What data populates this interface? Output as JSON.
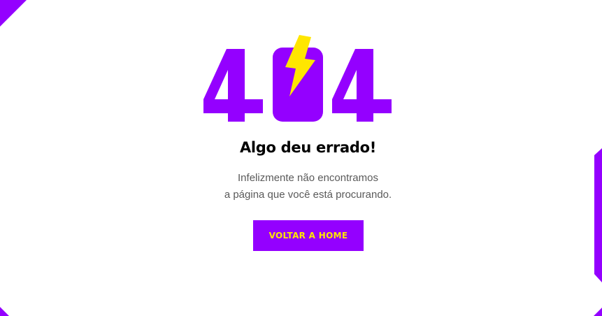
{
  "error": {
    "code": "404",
    "title": "Algo deu errado!",
    "message_line1": "Infelizmente não encontramos",
    "message_line2": "a página que você está procurando."
  },
  "actions": {
    "home_label": "VOLTAR A HOME"
  },
  "colors": {
    "accent": "#9400ff",
    "highlight": "#ffe600",
    "text_primary": "#000000",
    "text_secondary": "#5a5a5a",
    "background": "#ffffff"
  },
  "icons": {
    "bolt": "lightning-bolt-icon"
  }
}
